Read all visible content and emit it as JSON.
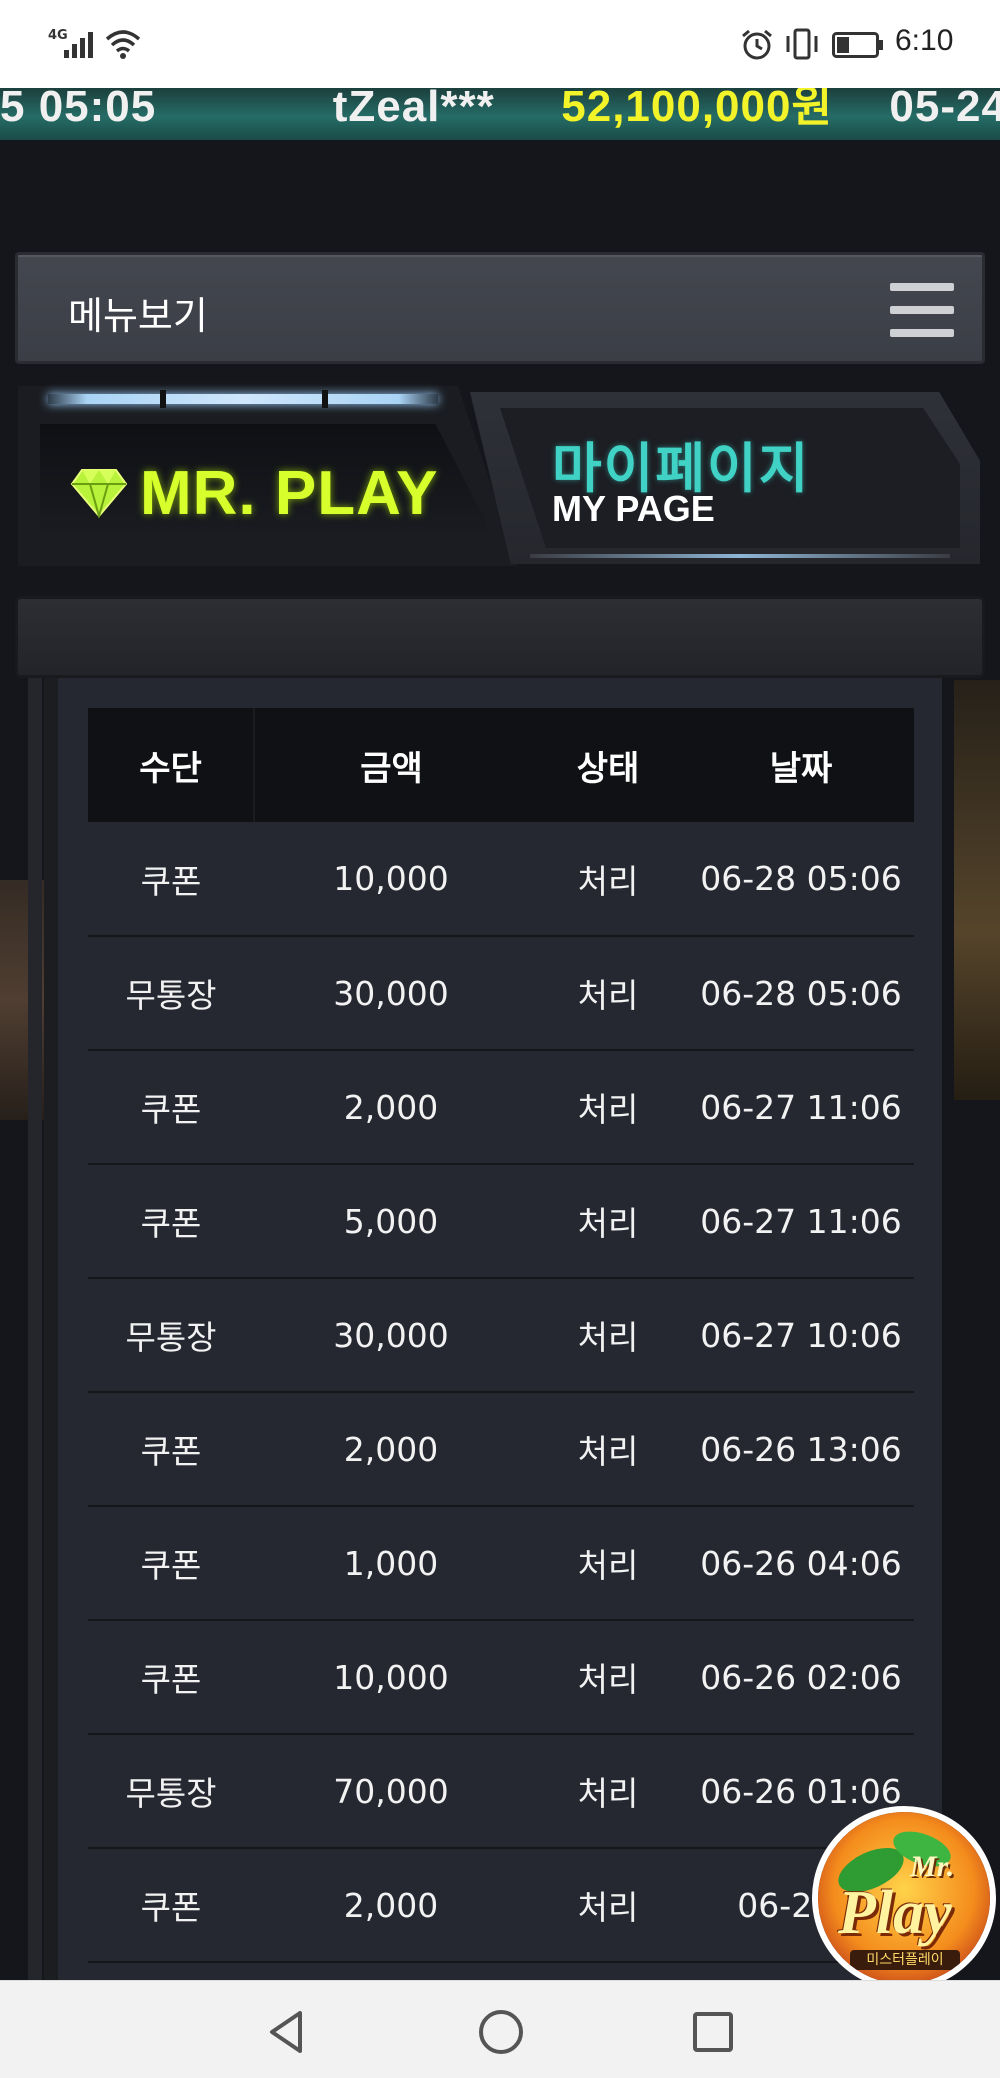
{
  "status_bar": {
    "network": "4G",
    "time": "6:10"
  },
  "ticker": {
    "text_left": "5 05:05",
    "text_user": "tZeal***",
    "text_amount": "52,100,000원",
    "text_right": "05-24"
  },
  "menu": {
    "label": "메뉴보기"
  },
  "header": {
    "brand": "MR. PLAY",
    "title_ko": "마이페이지",
    "title_en": "MY PAGE"
  },
  "table": {
    "columns": [
      "수단",
      "금액",
      "상태",
      "날짜"
    ],
    "rows": [
      {
        "method": "쿠폰",
        "amount": "10,000",
        "status": "처리",
        "date": "06-28 05:06"
      },
      {
        "method": "무통장",
        "amount": "30,000",
        "status": "처리",
        "date": "06-28 05:06"
      },
      {
        "method": "쿠폰",
        "amount": "2,000",
        "status": "처리",
        "date": "06-27 11:06"
      },
      {
        "method": "쿠폰",
        "amount": "5,000",
        "status": "처리",
        "date": "06-27 11:06"
      },
      {
        "method": "무통장",
        "amount": "30,000",
        "status": "처리",
        "date": "06-27 10:06"
      },
      {
        "method": "쿠폰",
        "amount": "2,000",
        "status": "처리",
        "date": "06-26 13:06"
      },
      {
        "method": "쿠폰",
        "amount": "1,000",
        "status": "처리",
        "date": "06-26 04:06"
      },
      {
        "method": "쿠폰",
        "amount": "10,000",
        "status": "처리",
        "date": "06-26 02:06"
      },
      {
        "method": "무통장",
        "amount": "70,000",
        "status": "처리",
        "date": "06-26 01:06"
      },
      {
        "method": "쿠폰",
        "amount": "2,000",
        "status": "처리",
        "date": "06-24 1"
      }
    ]
  },
  "float_logo": {
    "mr": "Mr.",
    "play": "Play",
    "tagline": "미스터플레이"
  },
  "colors": {
    "brand_green": "#d7ff2c",
    "title_teal": "#3fd2c5",
    "panel_bg": "#262831",
    "header_bg": "#101114"
  },
  "icons": {
    "menu": "hamburger-icon",
    "brand": "gem-icon",
    "nav": [
      "back-icon",
      "home-icon",
      "recent-apps-icon"
    ]
  }
}
